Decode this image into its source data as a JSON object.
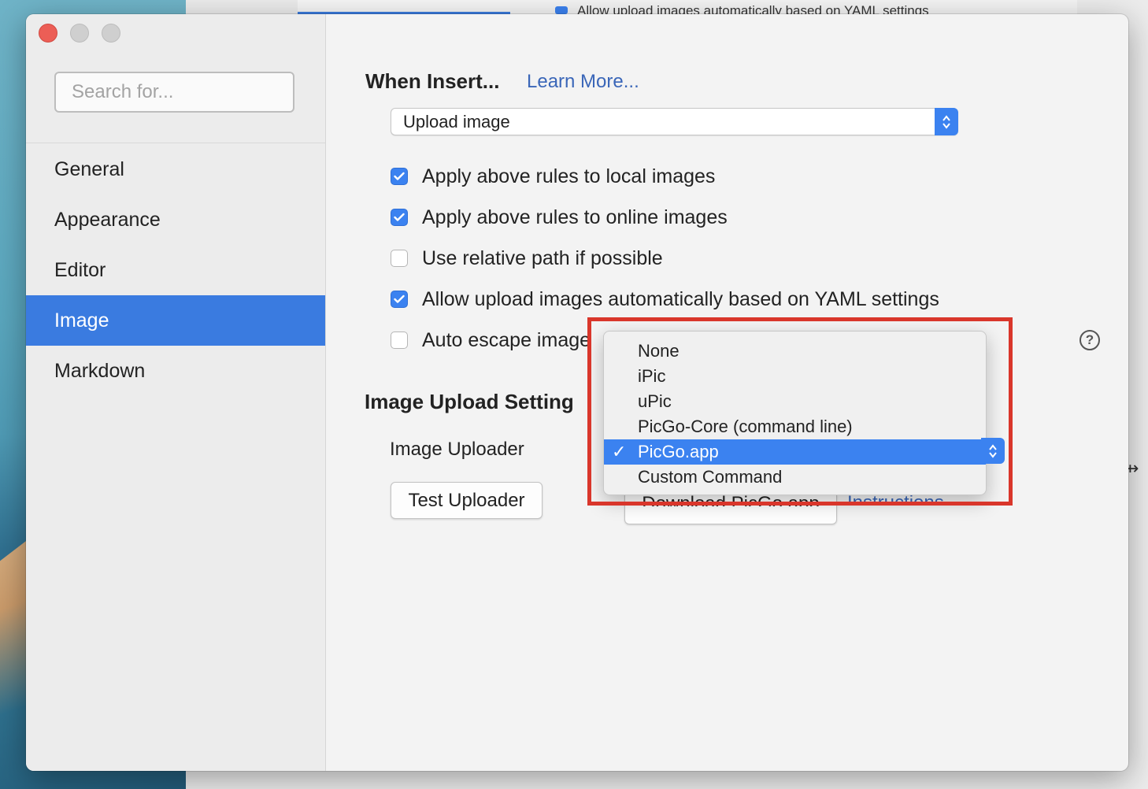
{
  "background_window": {
    "partial_text": "Allow upload images automatically based on YAML settings",
    "edge_glyph": "⇸"
  },
  "sidebar": {
    "search_placeholder": "Search for...",
    "items": [
      {
        "label": "General",
        "active": false
      },
      {
        "label": "Appearance",
        "active": false
      },
      {
        "label": "Editor",
        "active": false
      },
      {
        "label": "Image",
        "active": true
      },
      {
        "label": "Markdown",
        "active": false
      }
    ]
  },
  "when_insert": {
    "title": "When Insert...",
    "learn_more": "Learn More...",
    "select_value": "Upload image"
  },
  "options": [
    {
      "label": "Apply above rules to local images",
      "checked": true
    },
    {
      "label": "Apply above rules to online images",
      "checked": true
    },
    {
      "label": "Use relative path if possible",
      "checked": false
    },
    {
      "label": "Allow upload images automatically based on YAML settings",
      "checked": true
    },
    {
      "label": "Auto escape image",
      "checked": false
    }
  ],
  "upload_setting": {
    "title": "Image Upload Setting",
    "uploader_label": "Image Uploader",
    "test_button": "Test Uploader",
    "download_button": "Download PicGo app",
    "instructions_link": "Instructions"
  },
  "uploader_menu": {
    "options": [
      "None",
      "iPic",
      "uPic",
      "PicGo-Core (command line)",
      "PicGo.app",
      "Custom Command"
    ],
    "selected": "PicGo.app",
    "check_mark": "✓"
  },
  "colors": {
    "accent": "#3b82f0",
    "sidebar_active": "#3a7be0",
    "highlight_box": "#d9362b",
    "link": "#3a66b8"
  }
}
